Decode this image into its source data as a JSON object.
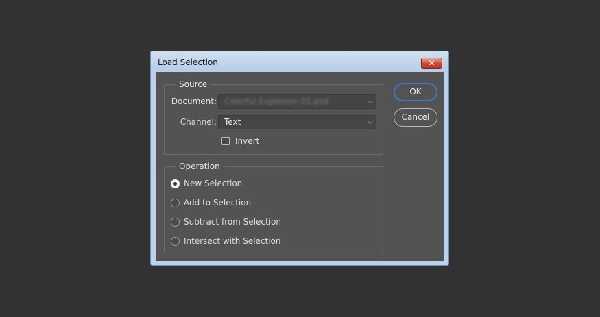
{
  "dialog": {
    "title": "Load Selection",
    "close_glyph": "✕",
    "source": {
      "label": "Source",
      "document_label": "Document:",
      "document_value": "Colorful Explosion 01.psd",
      "channel_label": "Channel:",
      "channel_value": "Text",
      "invert_label": "Invert",
      "invert_checked": false
    },
    "operation": {
      "label": "Operation",
      "options": [
        {
          "label": "New Selection",
          "selected": true
        },
        {
          "label": "Add to Selection",
          "selected": false
        },
        {
          "label": "Subtract from Selection",
          "selected": false
        },
        {
          "label": "Intersect with Selection",
          "selected": false
        }
      ]
    },
    "buttons": {
      "ok": "OK",
      "cancel": "Cancel"
    },
    "colors": {
      "desktop": "#323232",
      "panel": "#535353",
      "accent": "#3d78c8",
      "close": "#c24a36"
    }
  }
}
